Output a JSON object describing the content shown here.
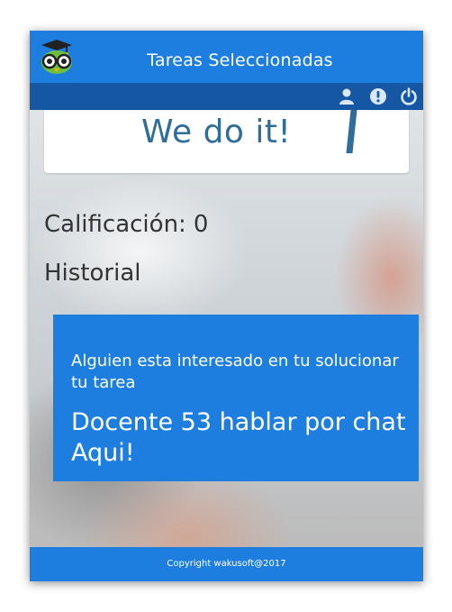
{
  "header": {
    "title": "Tareas Seleccionadas",
    "logo_icon": "owl-graduate-icon"
  },
  "toolbar": {
    "icons": [
      "user-icon",
      "info-icon",
      "power-icon"
    ]
  },
  "banner": {
    "text": "We do it!"
  },
  "grade": {
    "label": "Calificación:",
    "value": "0"
  },
  "history": {
    "label": "Historial"
  },
  "notice": {
    "message": "Alguien esta interesado en tu solucionar tu tarea",
    "link_text": "Docente 53 hablar por chat Aqui!"
  },
  "footer": {
    "copyright": "Copyright wakusoft@2017"
  },
  "colors": {
    "primary": "#1e7ee0",
    "secondary_bar": "#1657a3",
    "text_dark": "#333333"
  }
}
